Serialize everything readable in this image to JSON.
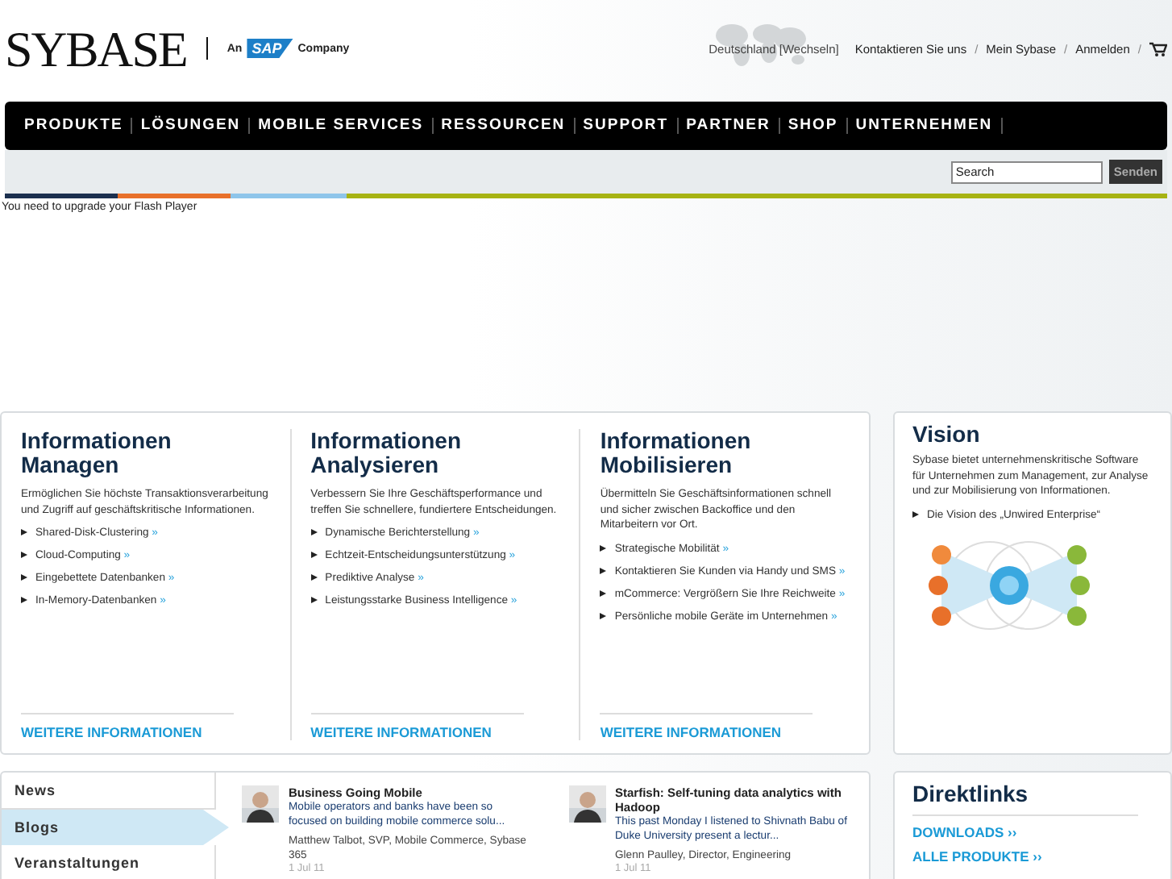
{
  "header": {
    "logo": "SYBASE",
    "tagline_prefix": "An",
    "tagline_brand": "SAP",
    "tagline_suffix": "Company",
    "region": "Deutschland [Wechseln]",
    "top_links": [
      "Kontaktieren Sie uns",
      "Mein Sybase",
      "Anmelden"
    ],
    "separator": "/"
  },
  "nav": [
    "PRODUKTE",
    "LÖSUNGEN",
    "MOBILE SERVICES",
    "RESSOURCEN",
    "SUPPORT",
    "PARTNER",
    "SHOP",
    "UNTERNEHMEN"
  ],
  "search": {
    "value": "Search",
    "button": "Senden"
  },
  "flash_notice": "You need to upgrade your Flash Player",
  "columns": [
    {
      "title": "Informationen Managen",
      "text": "Ermöglichen Sie höchste Transaktionsverarbeitung und Zugriff auf geschäftskritische Informationen.",
      "links": [
        {
          "label": "Shared-Disk-Clustering",
          "suffix": "»"
        },
        {
          "label": "Cloud-Computing",
          "suffix": "»"
        },
        {
          "label": "Eingebettete Datenbanken",
          "suffix": "»"
        },
        {
          "label": "In-Memory-Datenbanken",
          "suffix": "»"
        }
      ],
      "more": "WEITERE INFORMATIONEN"
    },
    {
      "title": "Informationen Analysieren",
      "text": "Verbessern Sie Ihre Geschäftsperformance und treffen Sie schnellere, fundiertere Entscheidungen.",
      "links": [
        {
          "label": "Dynamische Berichterstellung",
          "suffix": "»"
        },
        {
          "label": "Echtzeit-Entscheidungsunterstützung",
          "suffix": "»"
        },
        {
          "label": "Prediktive Analyse",
          "suffix": "»"
        },
        {
          "label": "Leistungsstarke Business Intelligence",
          "suffix": "»"
        }
      ],
      "more": "WEITERE INFORMATIONEN"
    },
    {
      "title": "Informationen Mobilisieren",
      "text": "Übermitteln Sie Geschäftsinformationen schnell und sicher zwischen Backoffice und den Mitarbeitern vor Ort.",
      "links": [
        {
          "label": "Strategische Mobilität",
          "suffix": "»"
        },
        {
          "label": "Kontaktieren Sie Kunden via Handy und SMS",
          "suffix": "»"
        },
        {
          "label": "mCommerce: Vergrößern Sie Ihre Reichweite",
          "suffix": "»"
        },
        {
          "label": "Persönliche mobile Geräte im Unternehmen",
          "suffix": "»"
        }
      ],
      "more": "WEITERE INFORMATIONEN"
    }
  ],
  "vision": {
    "title": "Vision",
    "text": "Sybase bietet unternehmenskritische Software für Unternehmen zum Management, zur Analyse und zur Mobilisierung von Informationen.",
    "link": "Die Vision des „Unwired Enterprise“"
  },
  "tabs": [
    {
      "label": "News",
      "selected": false
    },
    {
      "label": "Blogs",
      "selected": true
    },
    {
      "label": "Veranstaltungen",
      "selected": false
    }
  ],
  "posts": [
    {
      "title": "Business Going Mobile",
      "excerpt": "Mobile operators and banks have been so focused on building mobile commerce solu...",
      "author": "Matthew Talbot, SVP, Mobile Commerce, Sybase 365",
      "date": "1 Jul 11"
    },
    {
      "title": "Starfish: Self-tuning data analytics with Hadoop",
      "excerpt": "This past Monday I listened to Shivnath Babu of Duke University present a lectur...",
      "author": "Glenn Paulley, Director, Engineering",
      "date": "1 Jul 11"
    }
  ],
  "direktlinks": {
    "title": "Direktlinks",
    "links": [
      "DOWNLOADS ››",
      "ALLE PRODUKTE ››"
    ]
  }
}
